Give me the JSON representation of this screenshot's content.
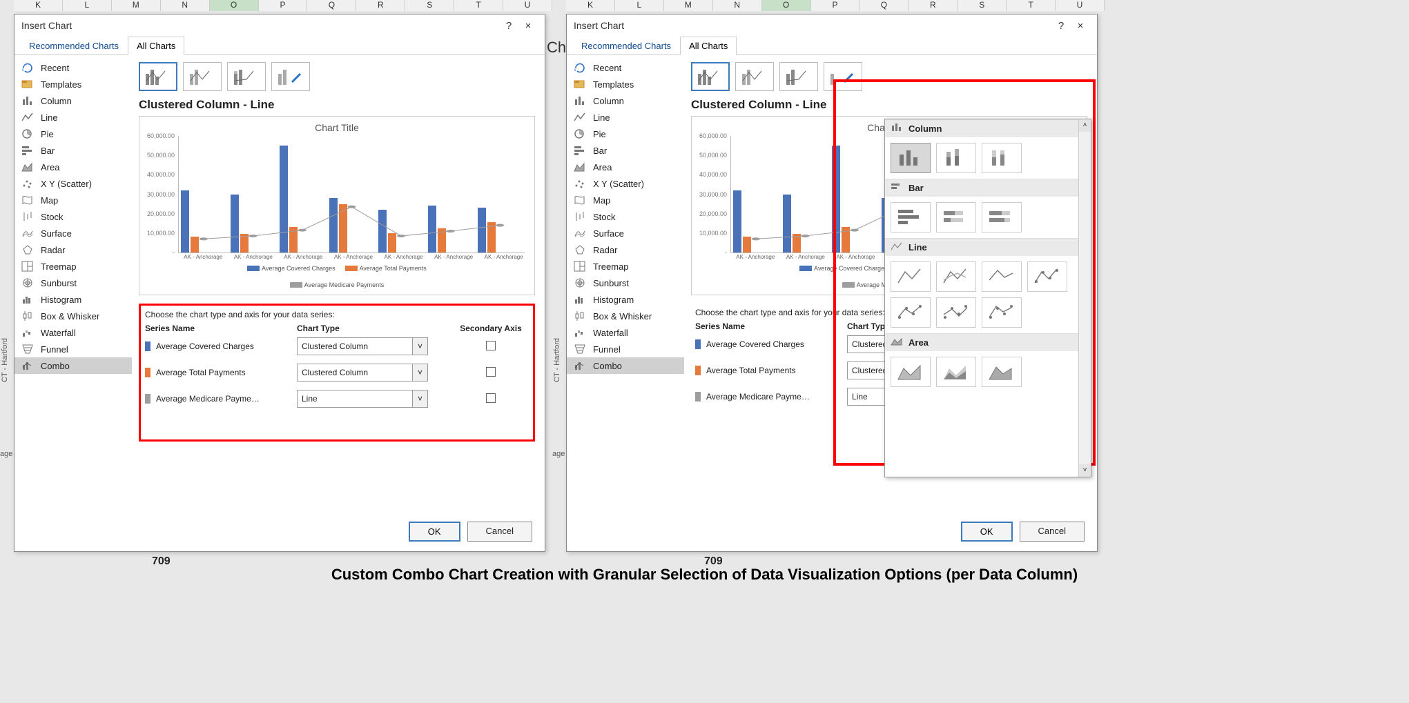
{
  "bg_cols": [
    "K",
    "L",
    "M",
    "N",
    "O",
    "P",
    "Q",
    "R",
    "S",
    "T",
    "U"
  ],
  "bg_selected": "O",
  "bg_ch_fragment": "Ch",
  "bg_vertical": "CT - Hartford",
  "bg_edge_label": "age",
  "bg_numbers_fragment": "709",
  "dialog": {
    "title": "Insert Chart",
    "help": "?",
    "close": "×",
    "tabs": {
      "rec": "Recommended Charts",
      "all": "All Charts"
    },
    "ok": "OK",
    "cancel": "Cancel"
  },
  "sidebar": [
    {
      "icon": "recent",
      "label": "Recent"
    },
    {
      "icon": "templates",
      "label": "Templates"
    },
    {
      "icon": "column",
      "label": "Column"
    },
    {
      "icon": "line",
      "label": "Line"
    },
    {
      "icon": "pie",
      "label": "Pie"
    },
    {
      "icon": "bar",
      "label": "Bar"
    },
    {
      "icon": "area",
      "label": "Area"
    },
    {
      "icon": "scatter",
      "label": "X Y (Scatter)"
    },
    {
      "icon": "map",
      "label": "Map"
    },
    {
      "icon": "stock",
      "label": "Stock"
    },
    {
      "icon": "surface",
      "label": "Surface"
    },
    {
      "icon": "radar",
      "label": "Radar"
    },
    {
      "icon": "treemap",
      "label": "Treemap"
    },
    {
      "icon": "sunburst",
      "label": "Sunburst"
    },
    {
      "icon": "histogram",
      "label": "Histogram"
    },
    {
      "icon": "box",
      "label": "Box & Whisker"
    },
    {
      "icon": "waterfall",
      "label": "Waterfall"
    },
    {
      "icon": "funnel",
      "label": "Funnel"
    },
    {
      "icon": "combo",
      "label": "Combo"
    }
  ],
  "subtype_name": "Clustered Column - Line",
  "preview": {
    "title": "Chart Title",
    "yticks": [
      "60,000.00",
      "50,000.00",
      "40,000.00",
      "30,000.00",
      "20,000.00",
      "10,000.00",
      "-"
    ],
    "categories": [
      "AK - Anchorage",
      "AK - Anchorage",
      "AK - Anchorage",
      "AK - Anchorage",
      "AK - Anchorage",
      "AK - Anchorage",
      "AK - Anchorage"
    ],
    "legend": [
      "Average Covered Charges",
      "Average Total Payments",
      "Average Medicare Payments"
    ]
  },
  "chart_data": {
    "type": "bar",
    "title": "Chart Title",
    "ylim": [
      0,
      60000
    ],
    "categories": [
      "AK - Anchorage",
      "AK - Anchorage",
      "AK - Anchorage",
      "AK - Anchorage",
      "AK - Anchorage",
      "AK - Anchorage",
      "AK - Anchorage"
    ],
    "series": [
      {
        "name": "Average Covered Charges",
        "type": "column",
        "values": [
          32000,
          30000,
          55000,
          28000,
          22000,
          24000,
          23000
        ]
      },
      {
        "name": "Average Total Payments",
        "type": "column",
        "values": [
          8000,
          9500,
          13000,
          25000,
          10000,
          12500,
          15500
        ]
      },
      {
        "name": "Average Medicare Payments",
        "type": "line",
        "values": [
          7000,
          8500,
          11500,
          23500,
          8500,
          11000,
          14000
        ]
      }
    ]
  },
  "series_section": {
    "prompt": "Choose the chart type and axis for your data series:",
    "hdr": {
      "name": "Series Name",
      "type": "Chart Type",
      "axis": "Secondary Axis"
    },
    "rows": [
      {
        "color": "#4a72b8",
        "name": "Average Covered Charges",
        "type": "Clustered Column"
      },
      {
        "color": "#e67a3d",
        "name": "Average Total Payments",
        "type": "Clustered Column"
      },
      {
        "color": "#9e9e9e",
        "name": "Average Medicare Payme…",
        "type": "Line"
      }
    ]
  },
  "flyout_sections": [
    {
      "label": "Column",
      "count": 3,
      "sel": 0
    },
    {
      "label": "Bar",
      "count": 3
    },
    {
      "label": "Line",
      "count": 7
    },
    {
      "label": "Area",
      "count": 3
    }
  ],
  "caption": "Custom Combo Chart Creation with Granular Selection of Data Visualization Options (per Data Column)"
}
